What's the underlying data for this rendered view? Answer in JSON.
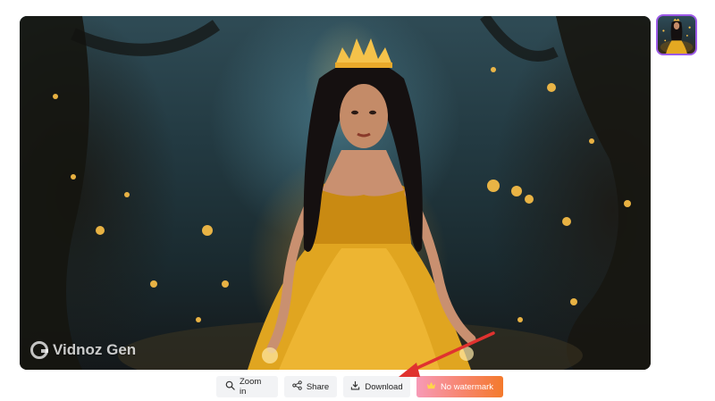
{
  "image": {
    "watermark_text": "Vidnoz Gen"
  },
  "toolbar": {
    "zoom_label": "Zoom in",
    "share_label": "Share",
    "download_label": "Download",
    "no_watermark_label": "No watermark"
  },
  "icons": {
    "zoom": "magnifier-icon",
    "share": "share-icon",
    "download": "download-icon",
    "no_watermark": "crown-icon",
    "annotation": "red-arrow-icon"
  },
  "colors": {
    "thumbnail_border": "#9b59e6",
    "annotation_arrow": "#e0322f",
    "button_bg": "#f2f3f5"
  }
}
